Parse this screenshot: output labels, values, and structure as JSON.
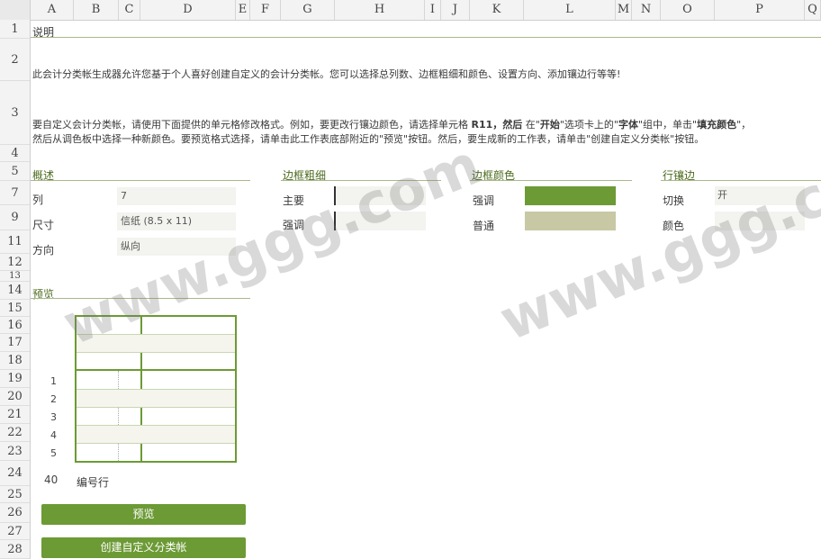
{
  "columns": [
    "A",
    "B",
    "C",
    "D",
    "E",
    "F",
    "G",
    "H",
    "I",
    "J",
    "K",
    "L",
    "M",
    "N",
    "O",
    "P",
    "Q"
  ],
  "rows": [
    "1",
    "2",
    "3",
    "4",
    "5",
    "6",
    "7",
    "8",
    "9",
    "10",
    "11",
    "12",
    "13",
    "14",
    "15",
    "16",
    "17",
    "18",
    "19",
    "20",
    "21",
    "22",
    "23",
    "24",
    "25",
    "26",
    "27",
    "28"
  ],
  "visible_row_labels": [
    "1",
    "2",
    "3",
    "4",
    "5",
    "7",
    "9",
    "11",
    "12",
    "13",
    "14",
    "15",
    "16",
    "17",
    "18",
    "19",
    "20",
    "21",
    "22",
    "23",
    "24",
    "25",
    "26",
    "27",
    "28"
  ],
  "note_label": "说明",
  "intro_text": "此会计分类帐生成器允许您基于个人喜好创建自定义的会计分类帐。您可以选择总列数、边框粗细和颜色、设置方向、添加镶边行等等!",
  "instruction_line1_a": "要自定义会计分类帐，请使用下面提供的单元格修改格式。例如，要更改行镶边颜色，请选择单元格 ",
  "instruction_line1_b": "R11，然后",
  "instruction_line1_c": " 在\"",
  "instruction_line1_d": "开始",
  "instruction_line1_e": "\"选项卡上的\"",
  "instruction_line1_f": "字体",
  "instruction_line1_g": "\"组中，单击\"",
  "instruction_line1_h": "填充颜色",
  "instruction_line1_i": "\"，",
  "instruction_line2": "然后从调色板中选择一种新颜色。要预览格式选择，请单击此工作表底部附近的\"预览\"按钮。然后，要生成新的工作表，请单击\"创建自定义分类帐\"按钮。",
  "overview": {
    "heading": "概述",
    "columns_label": "列",
    "columns_value": "7",
    "size_label": "尺寸",
    "size_value": "信纸 (8.5 x 11)",
    "orientation_label": "方向",
    "orientation_value": "纵向"
  },
  "border_thickness": {
    "heading": "边框粗细",
    "main_label": "主要",
    "accent_label": "强调"
  },
  "border_color": {
    "heading": "边框颜色",
    "accent_label": "强调",
    "normal_label": "普通",
    "accent_color": "#6c9a35",
    "normal_color": "#c8c8a4"
  },
  "banded_rows": {
    "heading": "行镶边",
    "toggle_label": "切换",
    "toggle_value": "开",
    "color_label": "颜色"
  },
  "preview": {
    "heading": "预览",
    "row_numbers": [
      "1",
      "2",
      "3",
      "4",
      "5"
    ],
    "count": "40",
    "count_label": "编号行"
  },
  "buttons": {
    "preview": "预览",
    "create": "创建自定义分类帐"
  },
  "watermark": "www.ggg.com"
}
